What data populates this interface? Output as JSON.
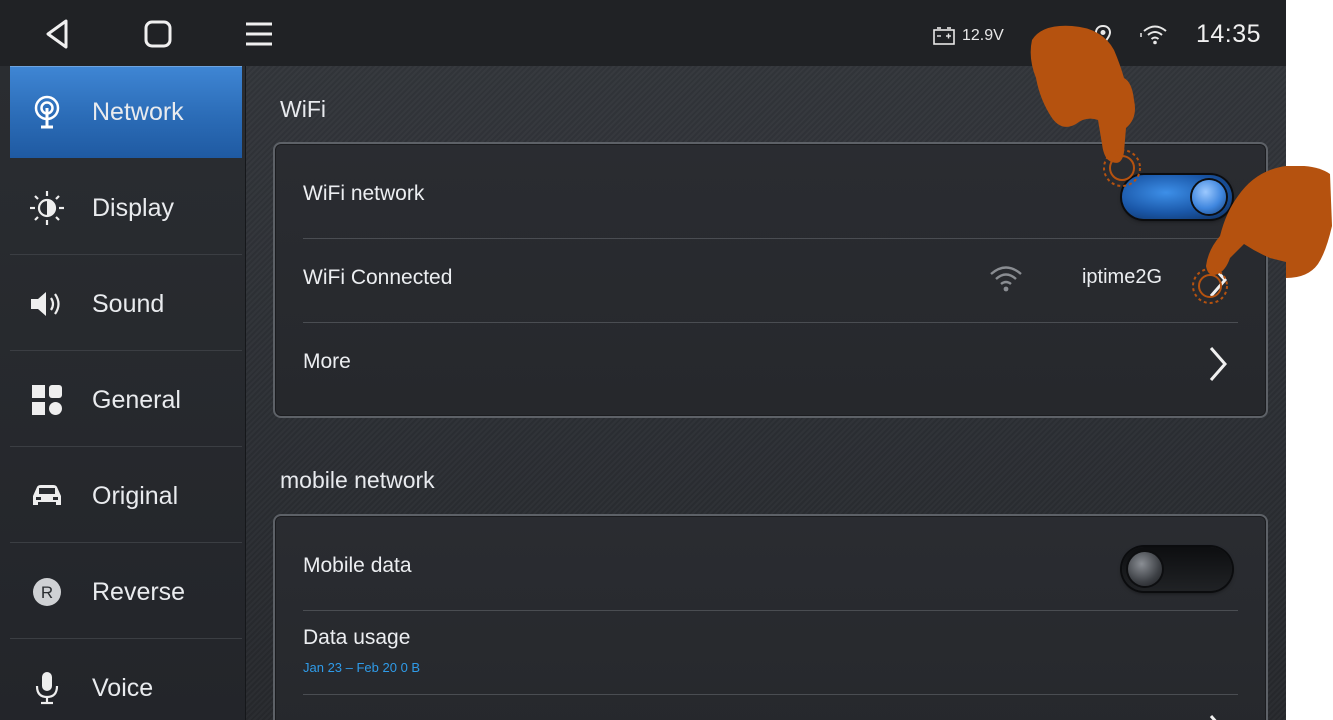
{
  "status_bar": {
    "voltage": "12.9V",
    "time": "14:35"
  },
  "sidebar": {
    "items": [
      {
        "label": "Network",
        "icon": "antenna-icon",
        "active": true
      },
      {
        "label": "Display",
        "icon": "brightness-icon",
        "active": false
      },
      {
        "label": "Sound",
        "icon": "speaker-icon",
        "active": false
      },
      {
        "label": "General",
        "icon": "grid-icon",
        "active": false
      },
      {
        "label": "Original",
        "icon": "car-icon",
        "active": false
      },
      {
        "label": "Reverse",
        "icon": "reverse-r-icon",
        "active": false
      },
      {
        "label": "Voice",
        "icon": "microphone-icon",
        "active": false
      }
    ]
  },
  "wifi_section": {
    "title": "WiFi",
    "rows": {
      "wifi_network": {
        "label": "WiFi network",
        "toggle": "on"
      },
      "wifi_connected": {
        "label": "WiFi Connected",
        "value": "iptime2G"
      },
      "more": {
        "label": "More"
      }
    }
  },
  "mobile_section": {
    "title": "mobile network",
    "rows": {
      "mobile_data": {
        "label": "Mobile data",
        "toggle": "off"
      },
      "data_usage": {
        "label": "Data usage",
        "sub": "Jan 23 – Feb 20 0 B"
      }
    }
  },
  "colors": {
    "accent_blue": "#2b6cb7",
    "sub_text_blue": "#2f9be8",
    "hand_overlay": "#b5520f"
  }
}
